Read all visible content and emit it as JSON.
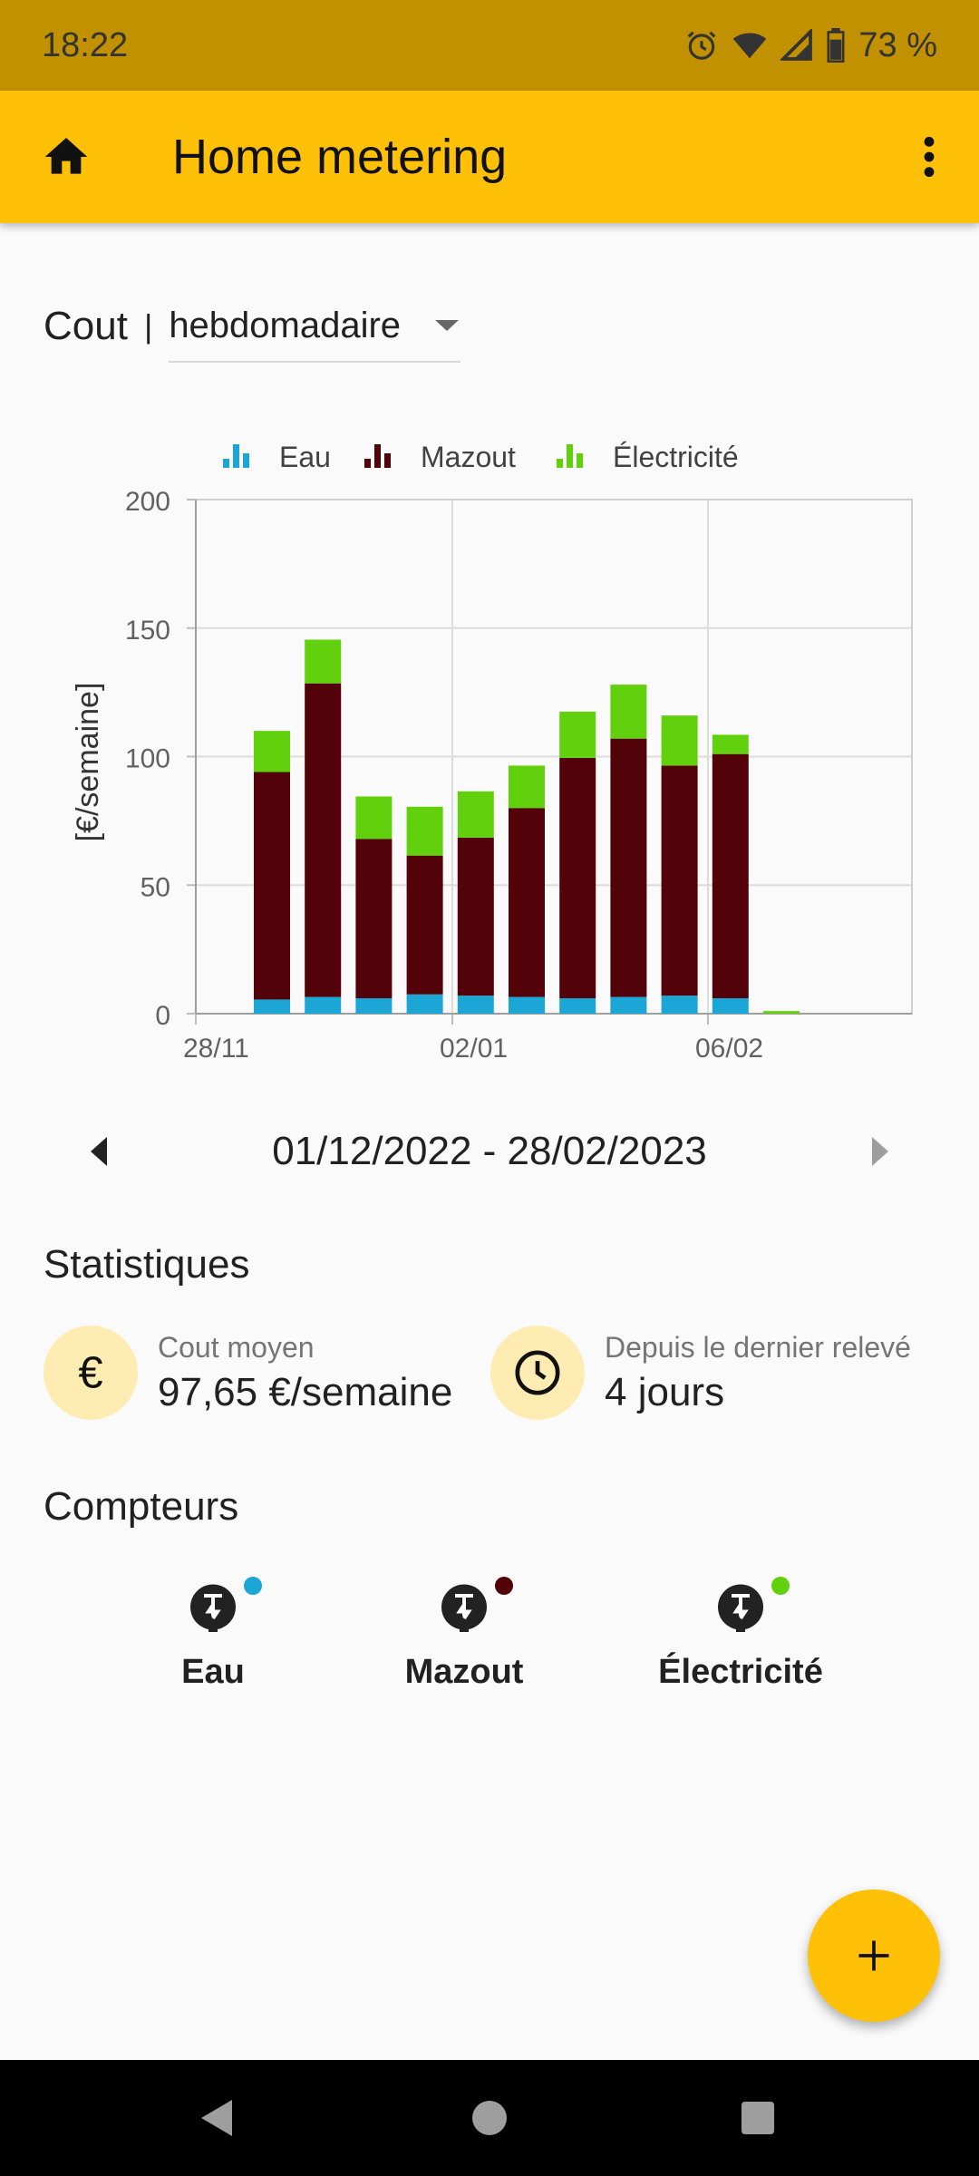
{
  "status_bar": {
    "time": "18:22",
    "battery": "73 %",
    "icons": [
      "alarm-icon",
      "wifi-icon",
      "signal-icon",
      "battery-icon"
    ]
  },
  "app_bar": {
    "title": "Home metering",
    "home_icon": "home-icon",
    "menu_icon": "more-vert-icon",
    "color": "#ffc107"
  },
  "selector": {
    "label": "Cout",
    "separator": "|",
    "value": "hebdomadaire"
  },
  "chart_data": {
    "type": "bar",
    "stacked": true,
    "legend": [
      "Eau",
      "Mazout",
      "Électricité"
    ],
    "legend_position": "top",
    "ylabel": "[€/semaine]",
    "ylim": [
      0,
      200
    ],
    "yticks": [
      "0",
      "50",
      "100",
      "150",
      "200"
    ],
    "xtick_labels": [
      "28/11",
      "02/01",
      "06/02"
    ],
    "grid": true,
    "series": [
      {
        "name": "Eau",
        "color": "#1ca6d6",
        "values": [
          5.5,
          6.5,
          6,
          7.5,
          7,
          6.5,
          6,
          6.5,
          7,
          6,
          0
        ]
      },
      {
        "name": "Mazout",
        "color": "#520208",
        "values": [
          88.5,
          122,
          62,
          54,
          61.5,
          73.5,
          93.5,
          100.5,
          89.5,
          95,
          0
        ]
      },
      {
        "name": "Électricité",
        "color": "#62d10d",
        "values": [
          16,
          17,
          16.5,
          19,
          18,
          16.5,
          18,
          21,
          19.5,
          7.5,
          1
        ]
      }
    ]
  },
  "date_nav": {
    "range": "01/12/2022 - 28/02/2023",
    "prev_icon": "arrow-left-icon",
    "next_icon": "arrow-right-icon"
  },
  "statistics": {
    "title": "Statistiques",
    "average_cost": {
      "label": "Cout moyen",
      "value": "97,65  €/semaine",
      "icon": "euro-icon"
    },
    "since_last": {
      "label": "Depuis le dernier relevé",
      "value": "4 jours",
      "icon": "clock-icon"
    }
  },
  "meters": {
    "title": "Compteurs",
    "items": [
      {
        "label": "Eau",
        "color": "#1ca6d6",
        "icon": "meter-icon"
      },
      {
        "label": "Mazout",
        "color": "#520208",
        "icon": "meter-icon"
      },
      {
        "label": "Électricité",
        "color": "#62d10d",
        "icon": "meter-icon"
      }
    ]
  },
  "fab": {
    "icon": "plus-icon"
  },
  "system_nav": {
    "icons": [
      "back-icon",
      "home-circle-icon",
      "recents-icon"
    ]
  }
}
